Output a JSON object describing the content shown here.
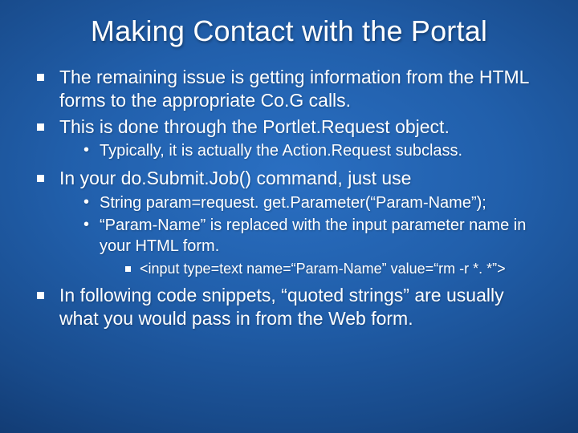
{
  "title": "Making Contact with the Portal",
  "bullets": {
    "b1": "The remaining issue is getting information from the HTML forms to the appropriate Co.G calls.",
    "b2": "This is done through the Portlet.Request object.",
    "b2a": "Typically, it is actually the Action.Request subclass.",
    "b3": "In your do.Submit.Job() command, just use",
    "b3a": "String param=request. get.Parameter(“Param-Name”);",
    "b3b": "“Param-Name” is replaced with the input parameter name in your HTML form.",
    "b3b1": "<input type=text name=“Param-Name” value=“rm -r *. *”>",
    "b4": "In following code snippets, “quoted strings” are usually what you would pass in from the Web form."
  }
}
